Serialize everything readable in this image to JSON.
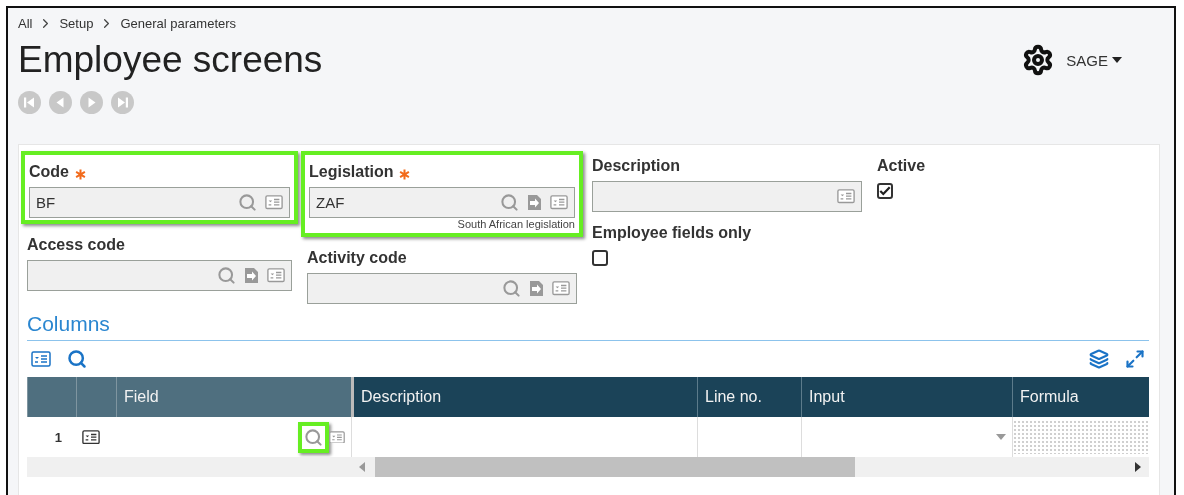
{
  "breadcrumb": [
    {
      "label": "All"
    },
    {
      "label": "Setup"
    },
    {
      "label": "General parameters"
    }
  ],
  "title": "Employee screens",
  "user": {
    "name": "SAGE"
  },
  "form": {
    "columns": [
      [
        {
          "kind": "code",
          "label": "Code",
          "required": true,
          "value": "BF",
          "highlighted": true
        },
        {
          "kind": "lookup",
          "label": "Access code",
          "required": false,
          "highlighted": false
        }
      ],
      [
        {
          "kind": "lookup",
          "label": "Legislation",
          "required": true,
          "value": "ZAF",
          "hint": "South African legislation",
          "highlighted": true
        },
        {
          "kind": "lookup",
          "label": "Activity code",
          "required": false,
          "highlighted": false
        }
      ],
      [
        {
          "kind": "text",
          "label": "Description",
          "required": false,
          "highlighted": false
        },
        {
          "kind": "checkbox",
          "label": "Employee fields only",
          "checked": false
        }
      ],
      [
        {
          "kind": "checkbox",
          "label": "Active",
          "checked": true
        }
      ]
    ]
  },
  "section": {
    "title": "Columns"
  },
  "grid": {
    "columns": [
      {
        "label": "Field",
        "kind": "lookup"
      },
      {
        "label": "Description",
        "kind": "text"
      },
      {
        "label": "Line no.",
        "kind": "text"
      },
      {
        "label": "Input",
        "kind": "select"
      },
      {
        "label": "Formula",
        "kind": "disabled"
      }
    ],
    "rows": [
      {
        "number": "1",
        "lookup_highlighted": true
      }
    ]
  }
}
